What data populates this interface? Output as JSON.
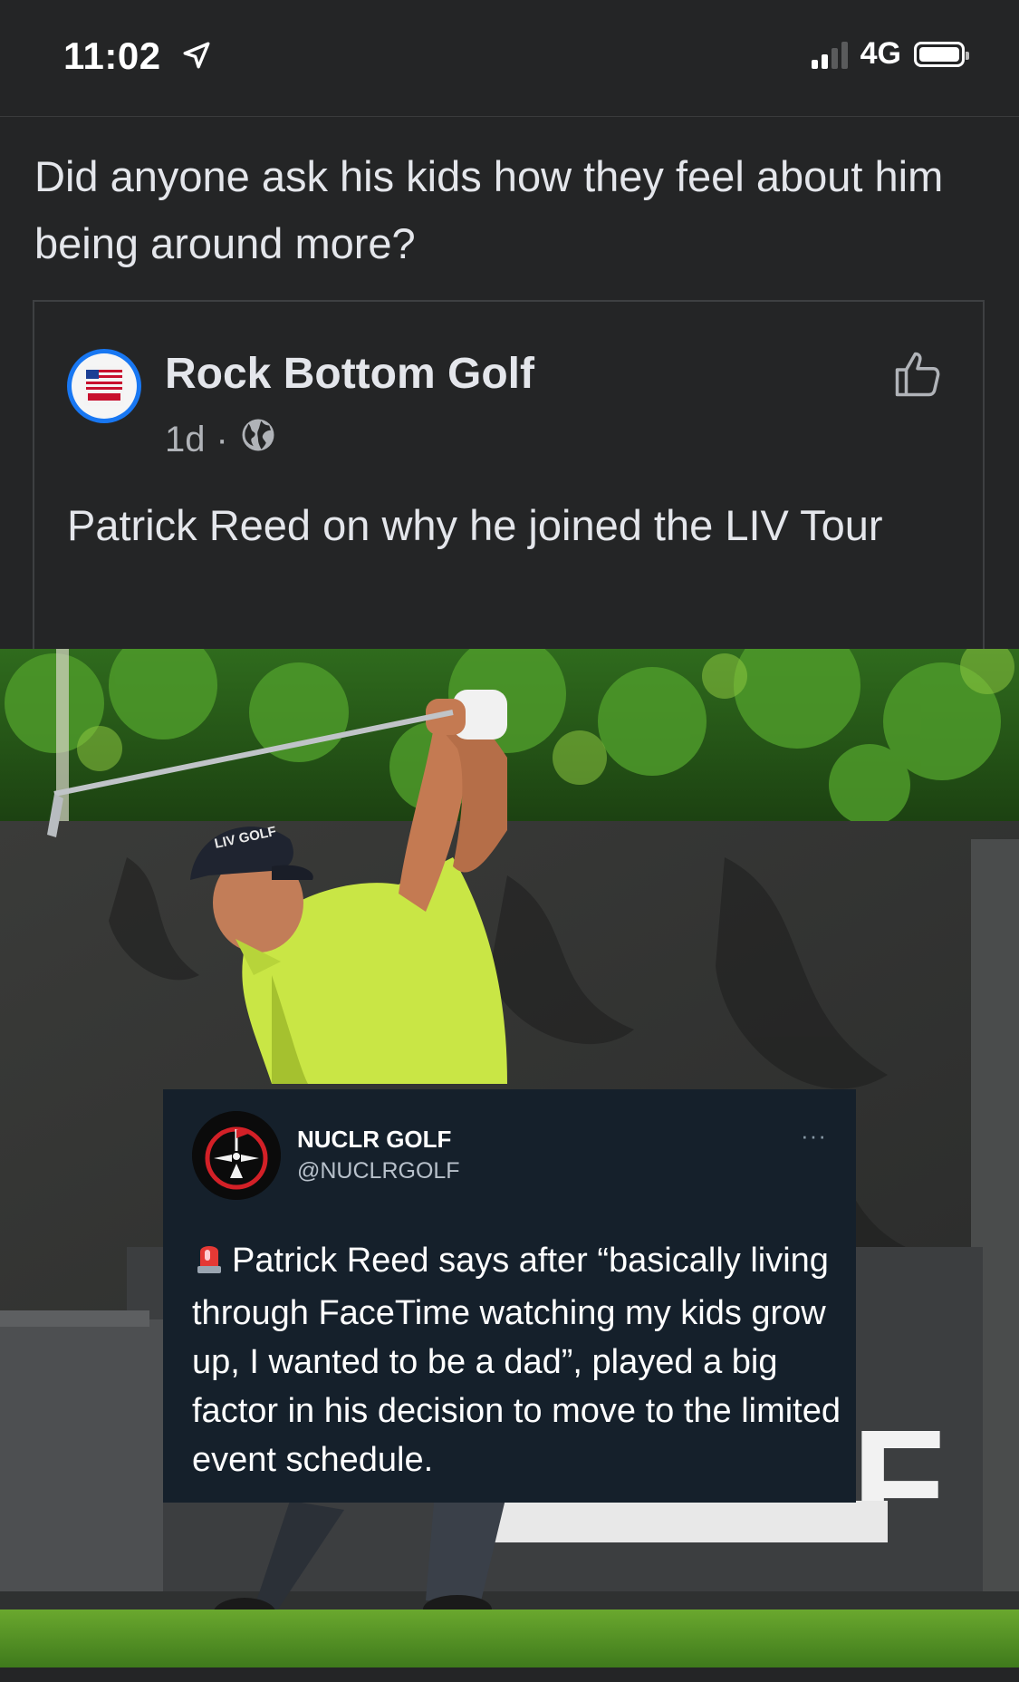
{
  "status_bar": {
    "time": "11:02",
    "network": "4G",
    "signal_bars_active": 2,
    "signal_bars_total": 4,
    "battery_level": 1.0,
    "icons": [
      "location-arrow-icon",
      "signal-icon",
      "battery-icon"
    ]
  },
  "post": {
    "text": "Did anyone ask his kids how they feel about him being around more?"
  },
  "shared_post": {
    "page_name": "Rock Bottom Golf",
    "time_ago": "1d",
    "separator": "·",
    "privacy_icon": "globe-icon",
    "action_icon": "thumbs-up-icon",
    "text": "Patrick Reed on why he joined the LIV Tour"
  },
  "photo": {
    "description_icon": "golfer-photo",
    "cap_logo": "LIV GOLF",
    "sign_text": "GOLF"
  },
  "tweet": {
    "name": "NUCLR GOLF",
    "handle": "@NUCLRGOLF",
    "more": "···",
    "emoji_icon": "siren-icon",
    "text": "Patrick Reed says after “basically living through FaceTime watching my kids grow up, I wanted to be a dad”, played a big factor in his decision to move to the limited event schedule."
  },
  "colors": {
    "background": "#242526",
    "text": "#e4e6eb",
    "secondary_text": "#b0b3b8",
    "avatar_ring": "#1877f2",
    "tweet_background": "#15202b"
  }
}
